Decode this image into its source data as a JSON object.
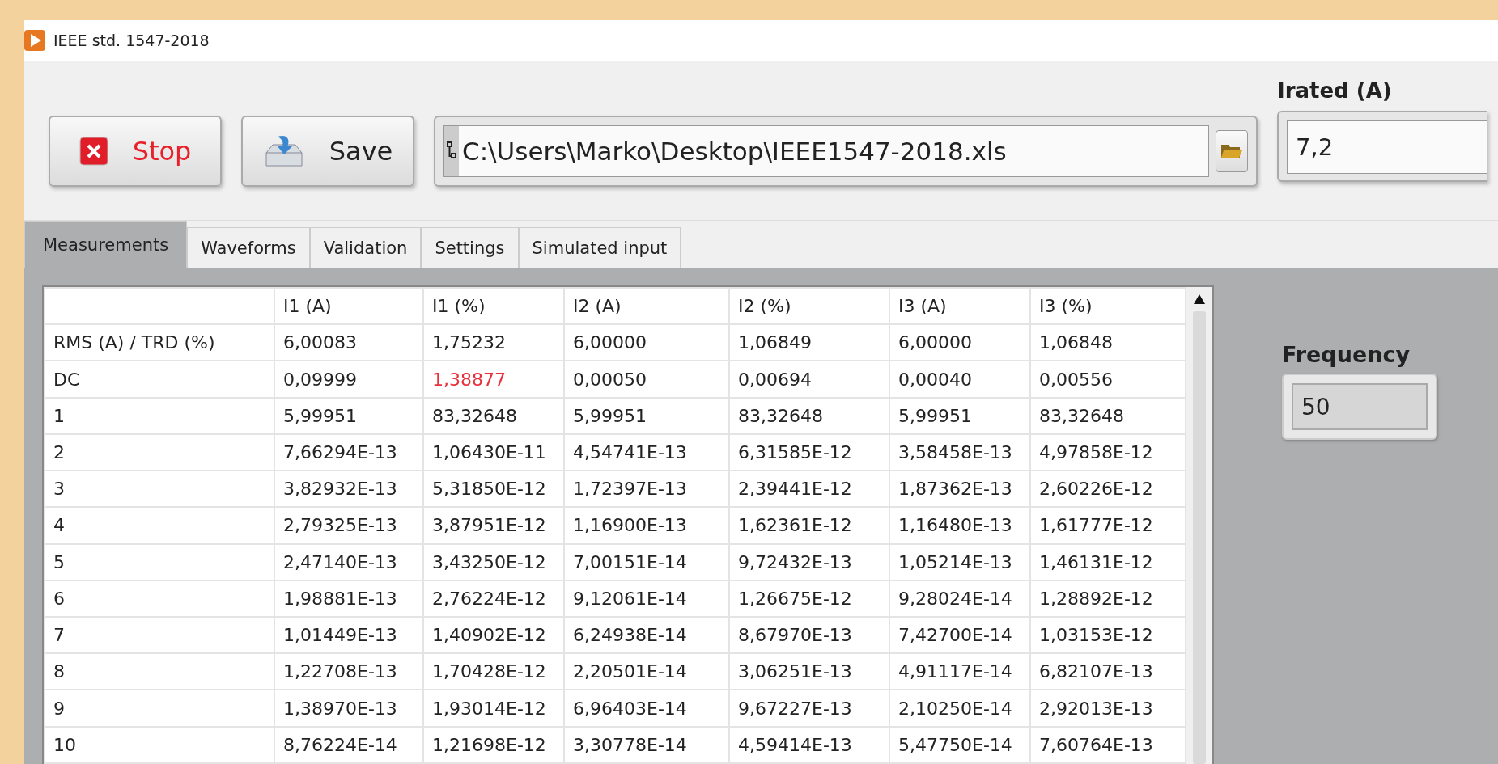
{
  "window": {
    "title": "IEEE std. 1547-2018"
  },
  "toolbar": {
    "stop_button": "Stop",
    "save_button": "Save",
    "file_path": "C:\\Users\\Marko\\Desktop\\IEEE1547-2018.xls",
    "irated": {
      "label": "Irated (A)",
      "value": "7,2"
    }
  },
  "tabs": [
    {
      "label": "Measurements",
      "selected": true
    },
    {
      "label": "Waveforms",
      "selected": false
    },
    {
      "label": "Validation",
      "selected": false
    },
    {
      "label": "Settings",
      "selected": false
    },
    {
      "label": "Simulated input",
      "selected": false
    }
  ],
  "table": {
    "columns": [
      "I1 (A)",
      "I1 (%)",
      "I2 (A)",
      "I2 (%)",
      "I3 (A)",
      "I3 (%)"
    ],
    "rows": [
      {
        "label": "RMS (A) / TRD (%)",
        "cells": [
          {
            "value": "6,00083",
            "alert": false
          },
          {
            "value": "1,75232",
            "alert": false
          },
          {
            "value": "6,00000",
            "alert": false
          },
          {
            "value": "1,06849",
            "alert": false
          },
          {
            "value": "6,00000",
            "alert": false
          },
          {
            "value": "1,06848",
            "alert": false
          }
        ]
      },
      {
        "label": "DC",
        "cells": [
          {
            "value": "0,09999",
            "alert": false
          },
          {
            "value": "1,38877",
            "alert": true
          },
          {
            "value": "0,00050",
            "alert": false
          },
          {
            "value": "0,00694",
            "alert": false
          },
          {
            "value": "0,00040",
            "alert": false
          },
          {
            "value": "0,00556",
            "alert": false
          }
        ]
      },
      {
        "label": "1",
        "cells": [
          {
            "value": "5,99951",
            "alert": false
          },
          {
            "value": "83,32648",
            "alert": false
          },
          {
            "value": "5,99951",
            "alert": false
          },
          {
            "value": "83,32648",
            "alert": false
          },
          {
            "value": "5,99951",
            "alert": false
          },
          {
            "value": "83,32648",
            "alert": false
          }
        ]
      },
      {
        "label": "2",
        "cells": [
          {
            "value": "7,66294E-13",
            "alert": false
          },
          {
            "value": "1,06430E-11",
            "alert": false
          },
          {
            "value": "4,54741E-13",
            "alert": false
          },
          {
            "value": "6,31585E-12",
            "alert": false
          },
          {
            "value": "3,58458E-13",
            "alert": false
          },
          {
            "value": "4,97858E-12",
            "alert": false
          }
        ]
      },
      {
        "label": "3",
        "cells": [
          {
            "value": "3,82932E-13",
            "alert": false
          },
          {
            "value": "5,31850E-12",
            "alert": false
          },
          {
            "value": "1,72397E-13",
            "alert": false
          },
          {
            "value": "2,39441E-12",
            "alert": false
          },
          {
            "value": "1,87362E-13",
            "alert": false
          },
          {
            "value": "2,60226E-12",
            "alert": false
          }
        ]
      },
      {
        "label": "4",
        "cells": [
          {
            "value": "2,79325E-13",
            "alert": false
          },
          {
            "value": "3,87951E-12",
            "alert": false
          },
          {
            "value": "1,16900E-13",
            "alert": false
          },
          {
            "value": "1,62361E-12",
            "alert": false
          },
          {
            "value": "1,16480E-13",
            "alert": false
          },
          {
            "value": "1,61777E-12",
            "alert": false
          }
        ]
      },
      {
        "label": "5",
        "cells": [
          {
            "value": "2,47140E-13",
            "alert": false
          },
          {
            "value": "3,43250E-12",
            "alert": false
          },
          {
            "value": "7,00151E-14",
            "alert": false
          },
          {
            "value": "9,72432E-13",
            "alert": false
          },
          {
            "value": "1,05214E-13",
            "alert": false
          },
          {
            "value": "1,46131E-12",
            "alert": false
          }
        ]
      },
      {
        "label": "6",
        "cells": [
          {
            "value": "1,98881E-13",
            "alert": false
          },
          {
            "value": "2,76224E-12",
            "alert": false
          },
          {
            "value": "9,12061E-14",
            "alert": false
          },
          {
            "value": "1,26675E-12",
            "alert": false
          },
          {
            "value": "9,28024E-14",
            "alert": false
          },
          {
            "value": "1,28892E-12",
            "alert": false
          }
        ]
      },
      {
        "label": "7",
        "cells": [
          {
            "value": "1,01449E-13",
            "alert": false
          },
          {
            "value": "1,40902E-12",
            "alert": false
          },
          {
            "value": "6,24938E-14",
            "alert": false
          },
          {
            "value": "8,67970E-13",
            "alert": false
          },
          {
            "value": "7,42700E-14",
            "alert": false
          },
          {
            "value": "1,03153E-12",
            "alert": false
          }
        ]
      },
      {
        "label": "8",
        "cells": [
          {
            "value": "1,22708E-13",
            "alert": false
          },
          {
            "value": "1,70428E-12",
            "alert": false
          },
          {
            "value": "2,20501E-14",
            "alert": false
          },
          {
            "value": "3,06251E-13",
            "alert": false
          },
          {
            "value": "4,91117E-14",
            "alert": false
          },
          {
            "value": "6,82107E-13",
            "alert": false
          }
        ]
      },
      {
        "label": "9",
        "cells": [
          {
            "value": "1,38970E-13",
            "alert": false
          },
          {
            "value": "1,93014E-12",
            "alert": false
          },
          {
            "value": "6,96403E-14",
            "alert": false
          },
          {
            "value": "9,67227E-13",
            "alert": false
          },
          {
            "value": "2,10250E-14",
            "alert": false
          },
          {
            "value": "2,92013E-13",
            "alert": false
          }
        ]
      },
      {
        "label": "10",
        "cells": [
          {
            "value": "8,76224E-14",
            "alert": false
          },
          {
            "value": "1,21698E-12",
            "alert": false
          },
          {
            "value": "3,30778E-14",
            "alert": false
          },
          {
            "value": "4,59414E-13",
            "alert": false
          },
          {
            "value": "5,47750E-14",
            "alert": false
          },
          {
            "value": "7,60764E-13",
            "alert": false
          }
        ]
      }
    ]
  },
  "frequency": {
    "label": "Frequency",
    "value": "50"
  }
}
